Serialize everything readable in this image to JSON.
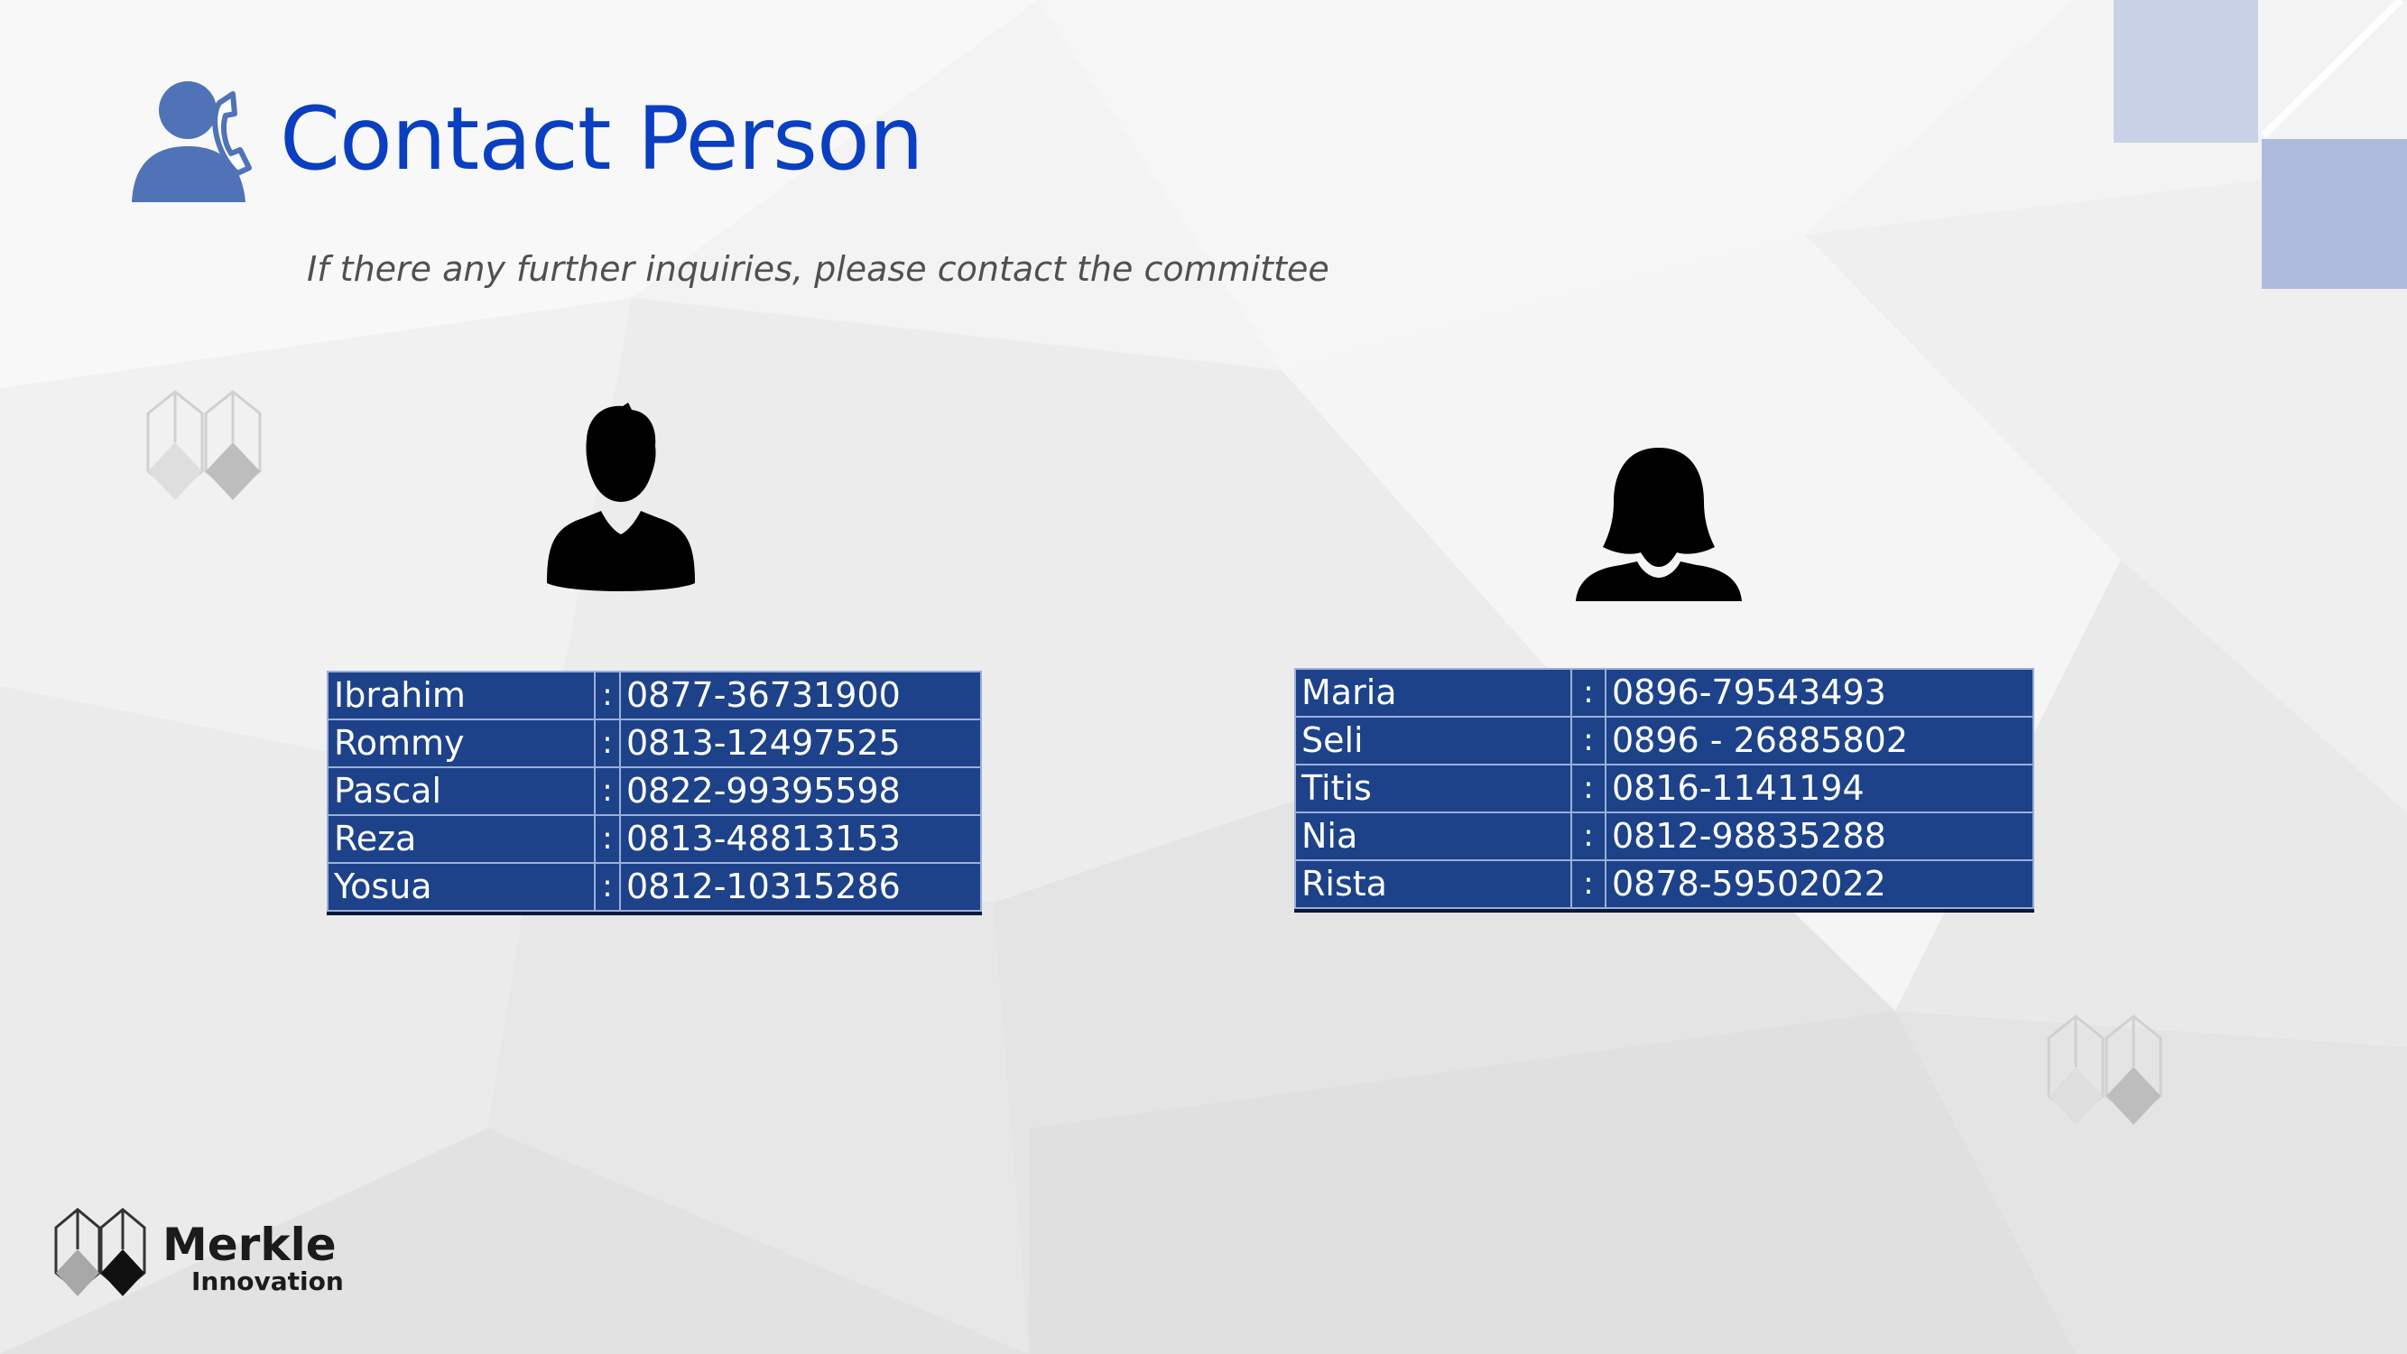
{
  "header": {
    "title": "Contact Person",
    "subtitle": "If there any further inquiries, please contact the committee",
    "icon": "phone-contact-icon"
  },
  "male_contacts": {
    "icon": "male-silhouette-icon",
    "rows": [
      {
        "name": "Ibrahim",
        "separator": ":",
        "phone": "0877-36731900"
      },
      {
        "name": "Rommy",
        "separator": ":",
        "phone": "0813-12497525"
      },
      {
        "name": "Pascal",
        "separator": ":",
        "phone": "0822-99395598"
      },
      {
        "name": "Reza",
        "separator": ":",
        "phone": "0813-48813153"
      },
      {
        "name": "Yosua",
        "separator": ":",
        "phone": "0812-10315286"
      }
    ]
  },
  "female_contacts": {
    "icon": "female-silhouette-icon",
    "rows": [
      {
        "name": "Maria",
        "separator": ":",
        "phone": "0896-79543493"
      },
      {
        "name": "Seli",
        "separator": ":",
        "phone": "0896 - 26885802"
      },
      {
        "name": "Titis",
        "separator": ":",
        "phone": "0816-1141194"
      },
      {
        "name": "Nia",
        "separator": ":",
        "phone": "0812-98835288"
      },
      {
        "name": "Rista",
        "separator": ":",
        "phone": "0878-59502022"
      }
    ]
  },
  "footer": {
    "brand_name": "Merkle",
    "brand_sub": "Innovation",
    "logo_icon": "merkle-logo-icon"
  },
  "colors": {
    "title": "#0b3fc1",
    "table_fill": "#1d428a",
    "table_border": "#9bb0d6",
    "accent_squares": "#b6c3df"
  }
}
